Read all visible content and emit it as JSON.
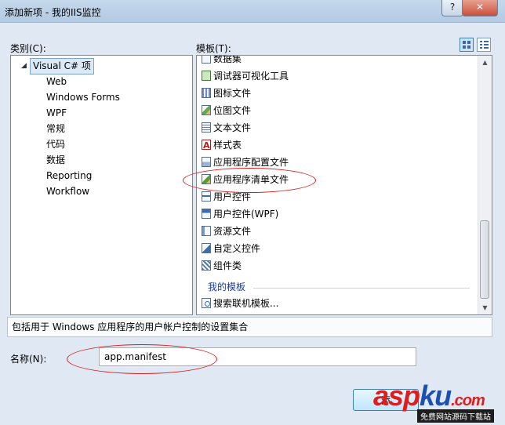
{
  "window": {
    "title": "添加新项 - 我的IIS监控",
    "help_glyph": "?",
    "close_glyph": "✕"
  },
  "categories": {
    "label": "类别(C):",
    "root": "Visual C# 项",
    "items": [
      "Web",
      "Windows Forms",
      "WPF",
      "常规",
      "代码",
      "数据",
      "Reporting",
      "Workflow"
    ]
  },
  "templates": {
    "label": "模板(T):",
    "items": [
      {
        "label": "数据集",
        "icon": "dataset-icon"
      },
      {
        "label": "调试器可视化工具",
        "icon": "cs-file-icon"
      },
      {
        "label": "图标文件",
        "icon": "icon-file-icon"
      },
      {
        "label": "位图文件",
        "icon": "bitmap-icon"
      },
      {
        "label": "文本文件",
        "icon": "text-file-icon"
      },
      {
        "label": "样式表",
        "icon": "stylesheet-icon"
      },
      {
        "label": "应用程序配置文件",
        "icon": "config-file-icon"
      },
      {
        "label": "应用程序清单文件",
        "icon": "manifest-file-icon"
      },
      {
        "label": "用户控件",
        "icon": "user-control-icon"
      },
      {
        "label": "用户控件(WPF)",
        "icon": "wpf-control-icon"
      },
      {
        "label": "资源文件",
        "icon": "resource-file-icon"
      },
      {
        "label": "自定义控件",
        "icon": "custom-control-icon"
      },
      {
        "label": "组件类",
        "icon": "component-class-icon"
      }
    ],
    "my_templates_heading": "我的模板",
    "search_online": "搜索联机模板..."
  },
  "description": "包括用于 Windows 应用程序的用户帐户控制的设置集合",
  "name_field": {
    "label": "名称(N):",
    "value": "app.manifest"
  },
  "buttons": {
    "add_visible_text": "添"
  },
  "watermark": {
    "brand_part1": "asp",
    "brand_part2": "ku",
    "brand_part3": ".com",
    "subtitle": "免费网站源码下载站"
  },
  "colors": {
    "annotation": "#d42020",
    "selection": "#dce9f6",
    "section_heading": "#1e3d8f"
  }
}
